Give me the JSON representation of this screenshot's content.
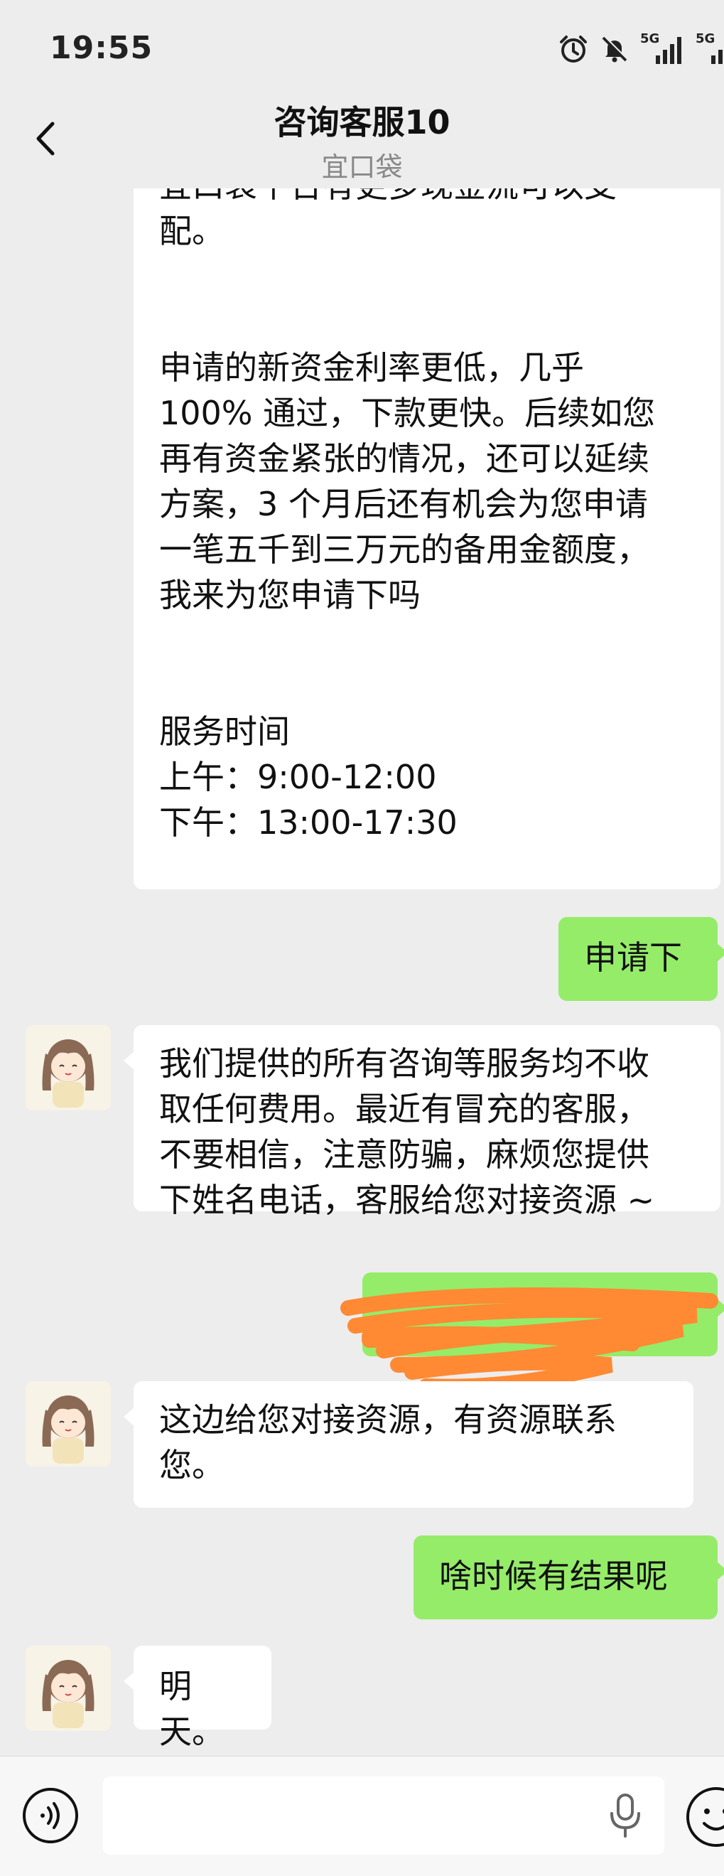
{
  "status_bar": {
    "time": "19:55",
    "icons": [
      "alarm-icon",
      "mute-icon",
      "signal-5g-icon",
      "signal-5g-icon"
    ],
    "network_1": "5G",
    "network_2": "5G"
  },
  "header": {
    "title": "咨询客服10",
    "subtitle": "宜口袋",
    "back_icon": "chevron-left-icon"
  },
  "messages": [
    {
      "direction": "incoming",
      "text": "宜口袋平台有更多现金流可以支\n配。\n\n\n申请的新资金利率更低，几乎\n100% 通过，下款更快。后续如您\n再有资金紧张的情况，还可以延续\n方案，3 个月后还有机会为您申请\n一笔五千到三万元的备用金额度，\n我来为您申请下吗\n\n\n服务时间\n上午：9:00-12:00\n下午：13:00-17:30"
    },
    {
      "direction": "outgoing",
      "text": "申请下"
    },
    {
      "direction": "incoming",
      "text": "我们提供的所有咨询等服务均不收\n取任何费用。最近有冒充的客服，\n不要相信，注意防骗，麻烦您提供\n下姓名电话，客服给您对接资源 ~"
    },
    {
      "direction": "outgoing",
      "text": "",
      "redacted": true,
      "redaction_color": "#ff8a33"
    },
    {
      "direction": "incoming",
      "text": "这边给您对接资源，有资源联系\n您。"
    },
    {
      "direction": "outgoing",
      "text": "啥时候有结果呢"
    },
    {
      "direction": "incoming",
      "text": "明天。"
    }
  ],
  "input_bar": {
    "voice_icon": "voice-input-icon",
    "placeholder": "",
    "mic_icon": "microphone-icon",
    "emoji_icon": "emoji-icon"
  },
  "colors": {
    "background": "#ededed",
    "outgoing_bubble": "#95ec69",
    "incoming_bubble": "#ffffff"
  }
}
